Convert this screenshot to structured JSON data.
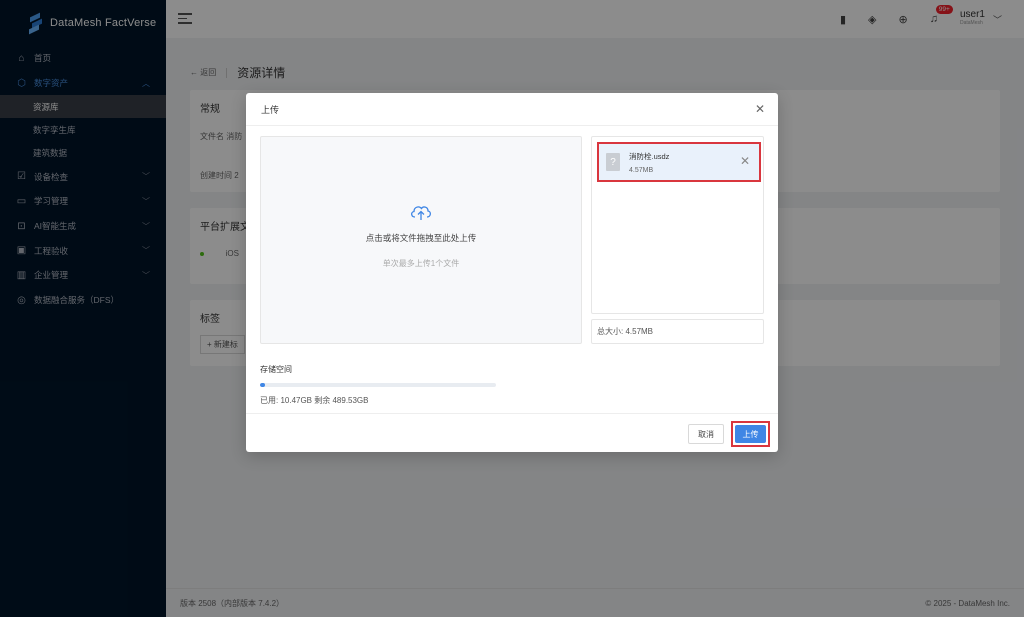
{
  "brand": {
    "name": "DataMesh FactVerse"
  },
  "sidebar": {
    "items": [
      {
        "label": "首页",
        "icon": "home-icon"
      },
      {
        "label": "数字资产",
        "icon": "cube-icon",
        "open": true
      },
      {
        "label": "设备检查",
        "icon": "checklist-icon"
      },
      {
        "label": "学习管理",
        "icon": "book-icon"
      },
      {
        "label": "AI智能生成",
        "icon": "ai-icon"
      },
      {
        "label": "工程验收",
        "icon": "calendar-icon"
      },
      {
        "label": "企业管理",
        "icon": "building-icon"
      },
      {
        "label": "数据融合服务（DFS）",
        "icon": "fusion-icon"
      }
    ],
    "subitems": [
      {
        "label": "资源库",
        "active": true
      },
      {
        "label": "数字孪生库"
      },
      {
        "label": "建筑数据"
      }
    ]
  },
  "topbar": {
    "badge": "99+",
    "user_name": "user1",
    "user_org": "DataMesh"
  },
  "page": {
    "back_label": "返回",
    "title": "资源详情",
    "card1_title": "常规",
    "card1_row1": "文件名 消防",
    "card1_row2": "创建时间 2",
    "card2_title": "平台扩展文",
    "card2_row": "iOS",
    "card3_title": "标签",
    "card3_add": "+ 新建标"
  },
  "footer": {
    "version": "版本 2508（内部版本 7.4.2）",
    "copyright": "© 2025 - DataMesh Inc."
  },
  "modal": {
    "title": "上传",
    "dropzone_main": "点击或将文件拖拽至此处上传",
    "dropzone_sub": "单次最多上传1个文件",
    "file": {
      "name": "消防栓.usdz",
      "size": "4.57MB"
    },
    "total_size": "总大小: 4.57MB",
    "storage_title": "存储空间",
    "storage_used_fraction": 0.021,
    "storage_usage": "已用: 10.47GB  剩余 489.53GB",
    "cancel_label": "取消",
    "upload_label": "上传"
  },
  "colors": {
    "primary": "#3f86e5",
    "sidebar": "#001529",
    "highlight": "#d9363e"
  }
}
